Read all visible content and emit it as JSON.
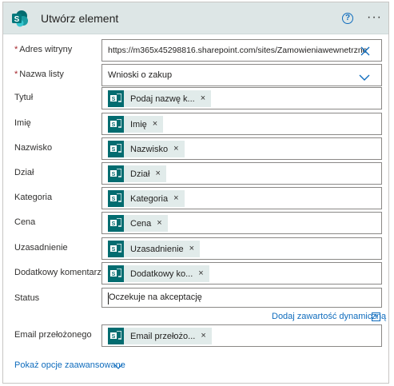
{
  "header": {
    "title": "Utwórz element",
    "icon": "sharepoint-logo-icon",
    "help_label": "?",
    "more_label": "···",
    "bg_color": "#dde6e6"
  },
  "fields": {
    "site": {
      "label": "Adres witryny",
      "required_mark": "*",
      "value": "https://m365x45298816.sharepoint.com/sites/Zamowieniawewnetrzne"
    },
    "list": {
      "label": "Nazwa listy",
      "required_mark": "*",
      "value": "Wnioski o zakup"
    },
    "tytul": {
      "label": "Tytuł",
      "token": "Podaj nazwę k..."
    },
    "imie": {
      "label": "Imię",
      "token": "Imię"
    },
    "nazwisko": {
      "label": "Nazwisko",
      "token": "Nazwisko"
    },
    "dzial": {
      "label": "Dział",
      "token": "Dział"
    },
    "kategoria": {
      "label": "Kategoria",
      "token": "Kategoria"
    },
    "cena": {
      "label": "Cena",
      "token": "Cena"
    },
    "uzasadnienie": {
      "label": "Uzasadnienie",
      "token": "Uzasadnienie"
    },
    "komentarz": {
      "label": "Dodatkowy komentarz",
      "token": "Dodatkowy ko..."
    },
    "status": {
      "label": "Status",
      "value": "Oczekuje na akceptację"
    },
    "email": {
      "label": "Email przełożonego",
      "token": "Email przełożo..."
    }
  },
  "token_remove": "×",
  "dynamic_content_link": "Dodaj zawartość dynamiczną",
  "dynamic_plus": "+",
  "advanced_link": "Pokaż opcje zaawansowane",
  "colors": {
    "accent": "#0f6cbd",
    "token_bg": "#e1ebea",
    "token_icon": "#036c70",
    "required": "#a4262c"
  }
}
